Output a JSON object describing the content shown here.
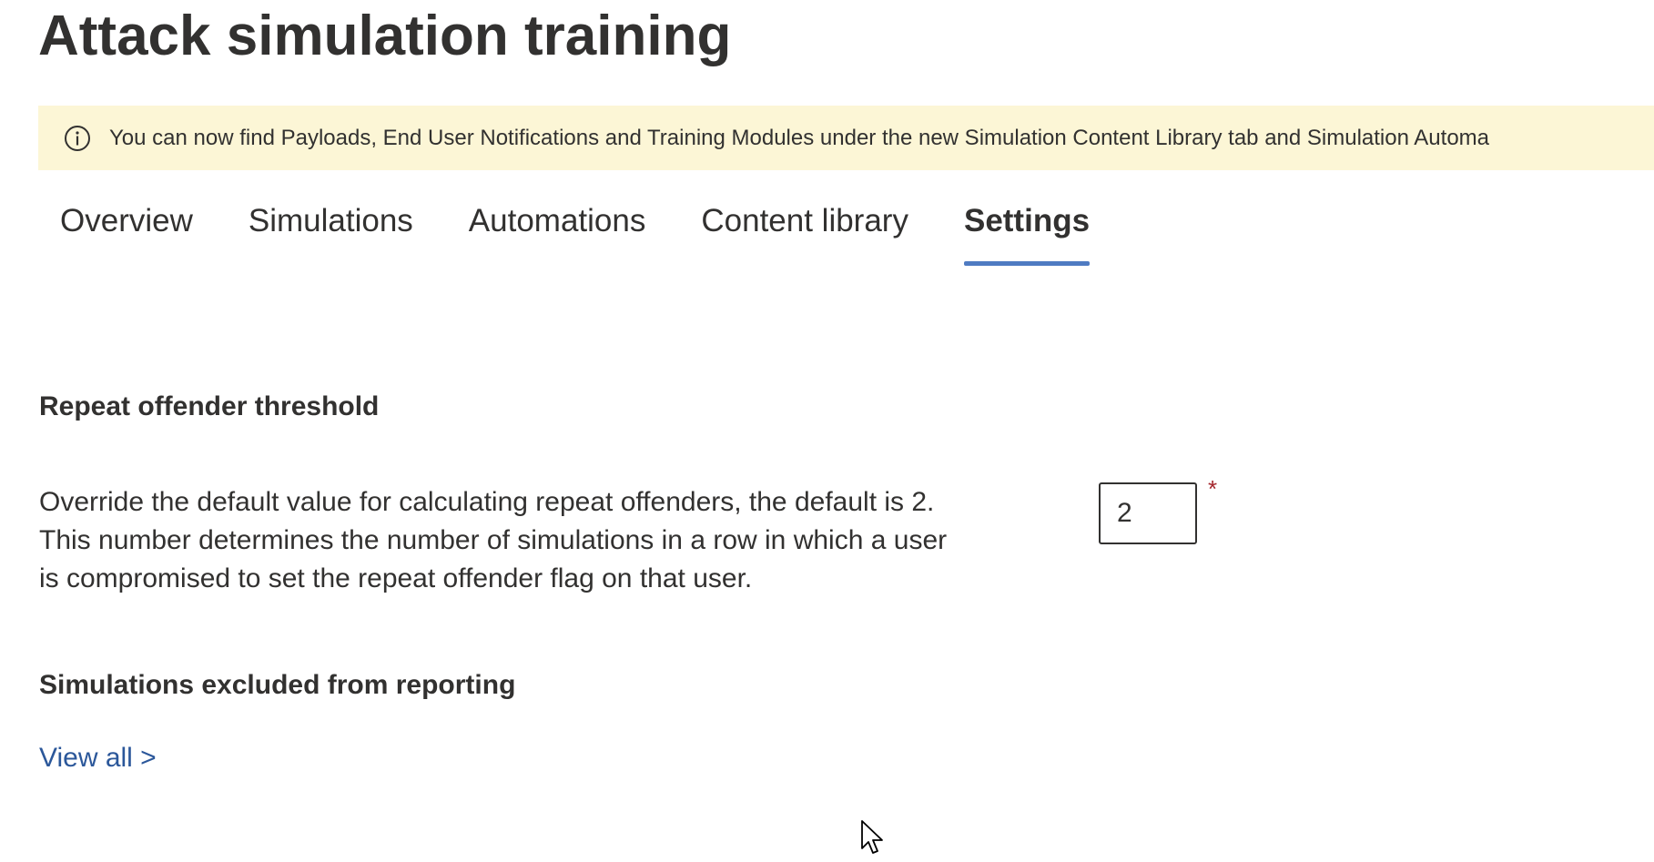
{
  "page": {
    "title": "Attack simulation training"
  },
  "banner": {
    "icon": "info-icon",
    "text": "You can now find Payloads, End User Notifications and Training Modules under the new Simulation Content Library tab and Simulation Automa",
    "background": "#fcf6d6"
  },
  "tabs": [
    {
      "label": "Overview",
      "active": false
    },
    {
      "label": "Simulations",
      "active": false
    },
    {
      "label": "Automations",
      "active": false
    },
    {
      "label": "Content library",
      "active": false
    },
    {
      "label": "Settings",
      "active": true
    }
  ],
  "settings": {
    "repeat_offender": {
      "heading": "Repeat offender threshold",
      "description": "Override the default value for calculating repeat offenders, the default is 2. This number determines the number of simulations in a row in which a user is compromised to set the repeat offender flag on that user.",
      "value": "2",
      "required_marker": "*"
    },
    "excluded": {
      "heading": "Simulations excluded from reporting",
      "link_label": "View all >"
    }
  },
  "colors": {
    "accent": "#4f7bc2",
    "link": "#2b579a",
    "required": "#a4262c",
    "text": "#323130"
  }
}
